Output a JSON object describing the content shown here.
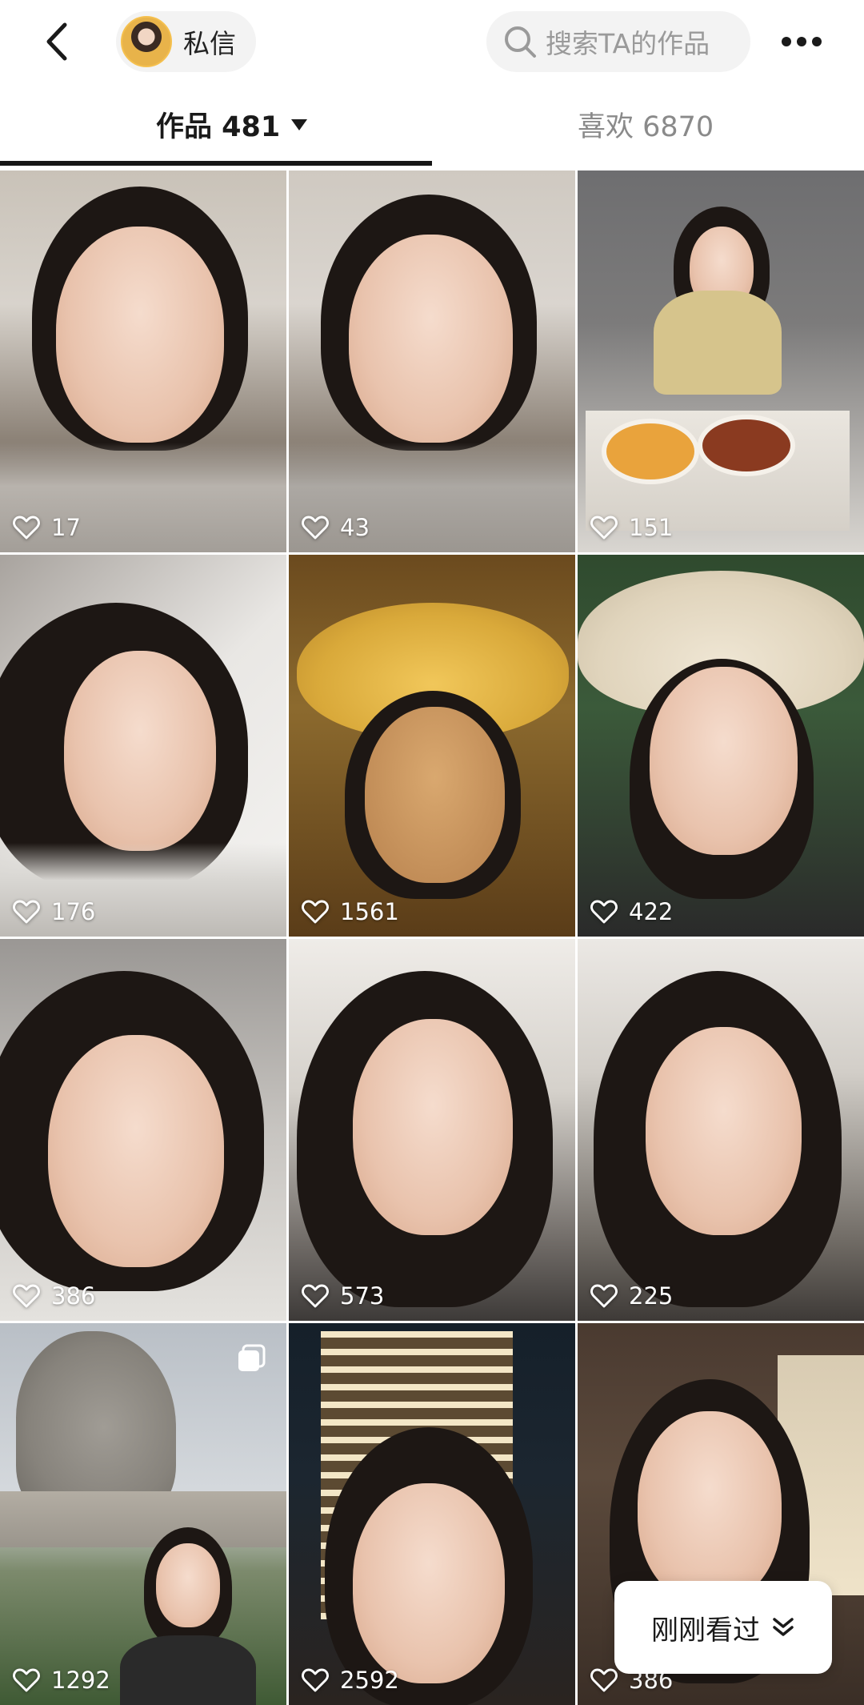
{
  "header": {
    "dm_label": "私信",
    "search_placeholder": "搜索TA的作品"
  },
  "tabs": {
    "works_label": "作品 481",
    "likes_label": "喜欢 6870"
  },
  "grid": {
    "items": [
      {
        "likes": "17"
      },
      {
        "likes": "43"
      },
      {
        "likes": "151"
      },
      {
        "likes": "176"
      },
      {
        "likes": "1561"
      },
      {
        "likes": "422"
      },
      {
        "likes": "386"
      },
      {
        "likes": "573"
      },
      {
        "likes": "225"
      },
      {
        "likes": "1292"
      },
      {
        "likes": "2592"
      },
      {
        "likes": "386"
      }
    ]
  },
  "floating": {
    "recent_label": "刚刚看过"
  },
  "colors": {
    "text_primary": "#1a1a1a",
    "text_secondary": "#8a8a8a",
    "pill_background": "#f3f3f3",
    "tab_indicator": "#161616"
  },
  "icons": {
    "back": "chevron-left-icon",
    "search": "search-icon",
    "more": "more-dots-icon",
    "like": "heart-outline-icon",
    "multi": "multi-image-icon",
    "expand": "chevron-double-down-icon"
  }
}
